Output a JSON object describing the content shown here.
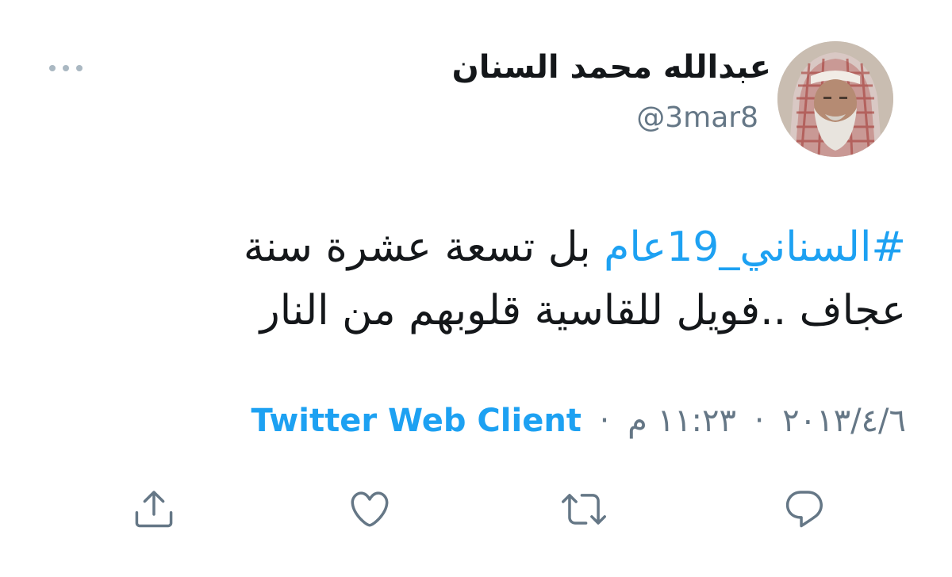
{
  "user": {
    "display_name": "عبدالله محمد السنان",
    "handle": "@3mar8"
  },
  "tweet": {
    "hashtag": "#السناني_19عام",
    "line1_rest": " بل تسعة عشرة سنة",
    "line2": "عجاف ..فويل للقاسية قلوبهم من النار"
  },
  "meta": {
    "date": "٢٠١٣/٤/٦",
    "separator": "·",
    "time": "١١:٢٣ م",
    "source": "Twitter Web Client"
  },
  "icons": {
    "more": "more-dots-icon",
    "reply": "reply-icon",
    "retweet": "retweet-icon",
    "like": "like-icon",
    "share": "share-icon"
  },
  "colors": {
    "link": "#1da1f2",
    "secondary": "#657786",
    "icon": "#657786"
  }
}
